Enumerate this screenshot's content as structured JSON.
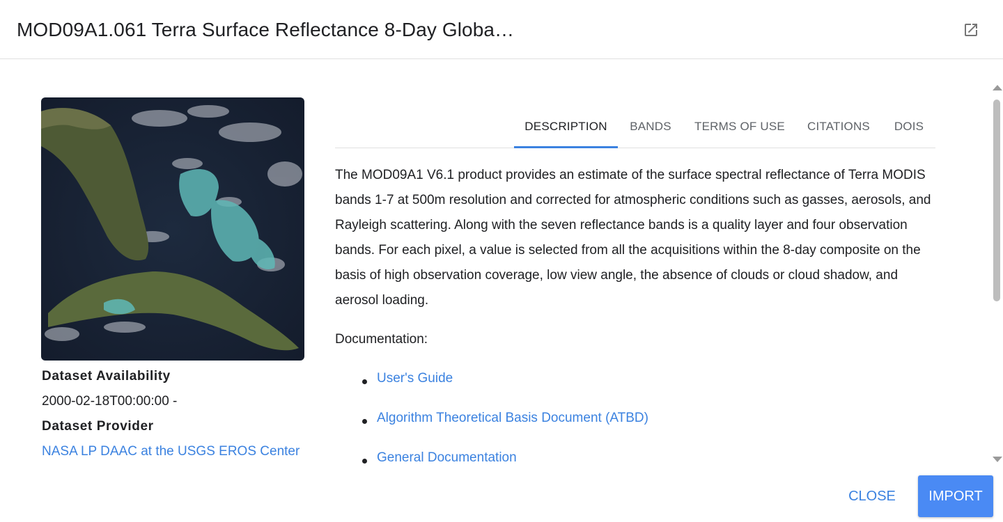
{
  "dialog": {
    "title": "MOD09A1.061 Terra Surface Reflectance 8-Day Globa…",
    "open_icon": "open-in-new-icon"
  },
  "sidebar": {
    "thumbnail_alt": "Satellite thumbnail of Florida, the Bahamas and Cuba",
    "availability_label": "Dataset Availability",
    "availability_value": "2000-02-18T00:00:00 -",
    "provider_label": "Dataset Provider",
    "provider_link": "NASA LP DAAC at the USGS EROS Center"
  },
  "tabs": [
    {
      "label": "DESCRIPTION",
      "active": true
    },
    {
      "label": "BANDS",
      "active": false
    },
    {
      "label": "TERMS OF USE",
      "active": false
    },
    {
      "label": "CITATIONS",
      "active": false
    },
    {
      "label": "DOIS",
      "active": false
    }
  ],
  "description": {
    "text": "The MOD09A1 V6.1 product provides an estimate of the surface spectral reflectance of Terra MODIS bands 1-7 at 500m resolution and corrected for atmospheric conditions such as gasses, aerosols, and Rayleigh scattering. Along with the seven reflectance bands is a quality layer and four observation bands. For each pixel, a value is selected from all the acquisitions within the 8-day composite on the basis of high observation coverage, low view angle, the absence of clouds or cloud shadow, and aerosol loading.",
    "documentation_label": "Documentation:",
    "documentation_links": [
      "User's Guide",
      "Algorithm Theoretical Basis Document (ATBD)",
      "General Documentation"
    ]
  },
  "actions": {
    "close": "CLOSE",
    "import": "IMPORT"
  },
  "colors": {
    "accent": "#3b82e0",
    "primary_button": "#4a8af4"
  }
}
